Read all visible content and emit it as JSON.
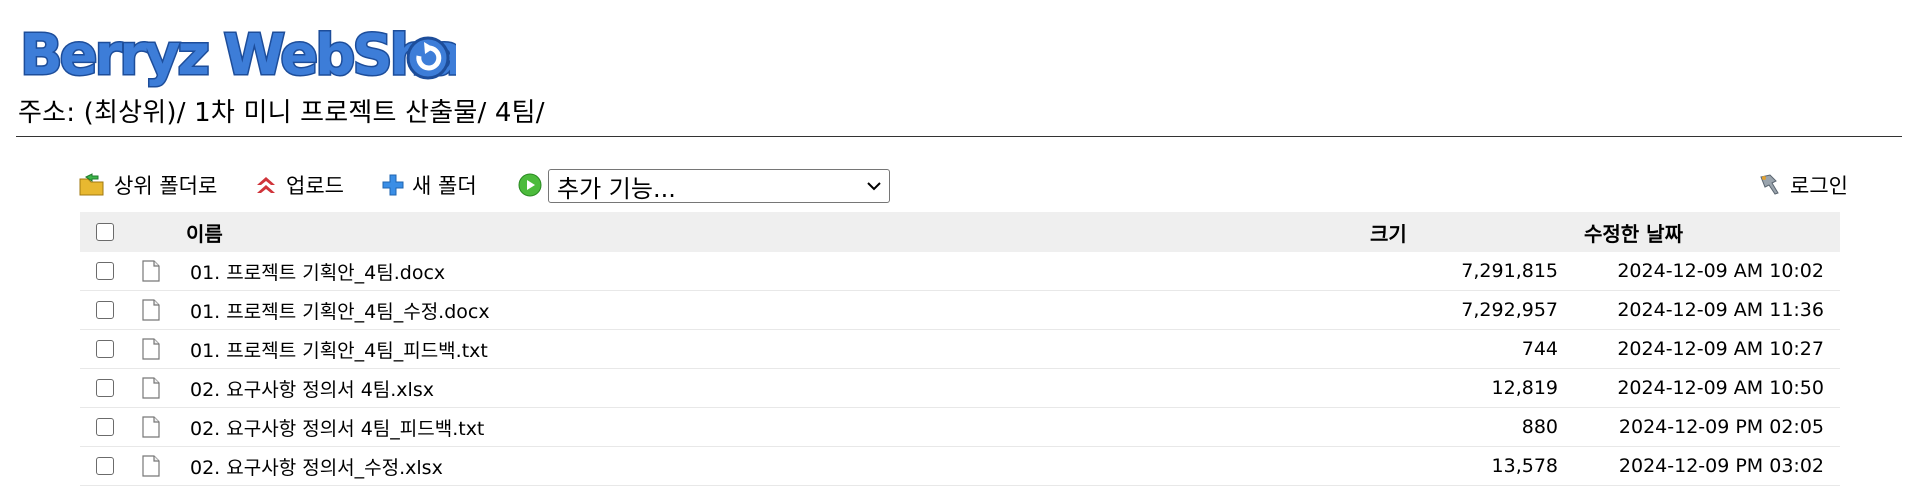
{
  "logo": {
    "text": "Berryz WebShare"
  },
  "address": {
    "label": "주소:",
    "path": "(최상위)/ 1차 미니 프로젝트 산출물/ 4팀/"
  },
  "toolbar": {
    "up_label": "상위 폴더로",
    "upload_label": "업로드",
    "new_folder_label": "새 폴더",
    "more_select": "추가 기능...",
    "login_label": "로그인"
  },
  "table": {
    "headers": {
      "name": "이름",
      "size": "크기",
      "date": "수정한 날짜"
    },
    "rows": [
      {
        "name": "01. 프로젝트 기획안_4팀.docx",
        "size": "7,291,815",
        "date": "2024-12-09 AM 10:02"
      },
      {
        "name": "01. 프로젝트 기획안_4팀_수정.docx",
        "size": "7,292,957",
        "date": "2024-12-09 AM 11:36"
      },
      {
        "name": "01. 프로젝트 기획안_4팀_피드백.txt",
        "size": "744",
        "date": "2024-12-09 AM 10:27"
      },
      {
        "name": "02. 요구사항 정의서 4팀.xlsx",
        "size": "12,819",
        "date": "2024-12-09 AM 10:50"
      },
      {
        "name": "02. 요구사항 정의서 4팀_피드백.txt",
        "size": "880",
        "date": "2024-12-09 PM 02:05"
      },
      {
        "name": "02. 요구사항 정의서_수정.xlsx",
        "size": "13,578",
        "date": "2024-12-09 PM 03:02"
      }
    ]
  }
}
